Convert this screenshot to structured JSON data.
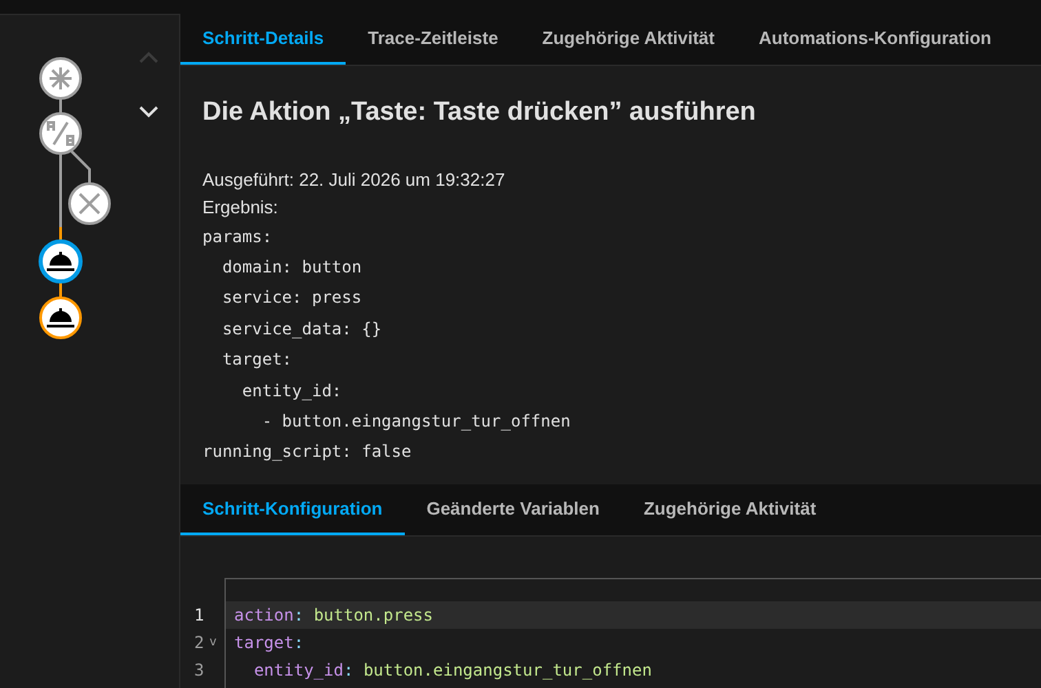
{
  "graph": {
    "nodes": [
      {
        "kind": "trigger",
        "color": "#9e9e9e",
        "selected": false
      },
      {
        "kind": "choose",
        "color": "#9e9e9e",
        "selected": false
      },
      {
        "kind": "stop",
        "color": "#9e9e9e",
        "selected": false
      },
      {
        "kind": "action",
        "color": "#039be5",
        "selected": true
      },
      {
        "kind": "action",
        "color": "#ff9800",
        "selected": false
      }
    ]
  },
  "nav": {
    "previous": {
      "disabled": true
    },
    "next": {
      "disabled": false
    }
  },
  "tabs": [
    {
      "label": "Schritt-Details",
      "selected": true
    },
    {
      "label": "Trace-Zeitleiste",
      "selected": false
    },
    {
      "label": "Zugehörige Aktivität",
      "selected": false
    },
    {
      "label": "Automations-Konfiguration",
      "selected": false
    }
  ],
  "details": {
    "title": "Die Aktion „Taste: Taste drücken” ausführen",
    "executed": "Ausgeführt: 22. Juli 2026 um 19:32:27",
    "result_label": "Ergebnis:",
    "result_lines": [
      "params:",
      "  domain: button",
      "  service: press",
      "  service_data: {}",
      "  target:",
      "    entity_id:",
      "      - button.eingangstur_tur_offnen",
      "running_script: false"
    ]
  },
  "sub_tabs": [
    {
      "label": "Schritt-Konfiguration",
      "selected": true
    },
    {
      "label": "Geänderte Variablen",
      "selected": false
    },
    {
      "label": "Zugehörige Aktivität",
      "selected": false
    }
  ],
  "editor": {
    "lines": [
      {
        "number": "1",
        "active": true,
        "segments": [
          {
            "kind": "key",
            "text": "action"
          },
          {
            "kind": "punct",
            "text": ": "
          },
          {
            "kind": "value",
            "text": "button.press"
          }
        ]
      },
      {
        "number": "2",
        "active": false,
        "fold": "v",
        "segments": [
          {
            "kind": "key",
            "text": "target"
          },
          {
            "kind": "punct",
            "text": ":"
          }
        ]
      },
      {
        "number": "3",
        "active": false,
        "segments": [
          {
            "kind": "key",
            "text": "  entity_id"
          },
          {
            "kind": "punct",
            "text": ": "
          },
          {
            "kind": "value",
            "text": "button.eingangstur_tur_offnen"
          }
        ]
      }
    ]
  }
}
